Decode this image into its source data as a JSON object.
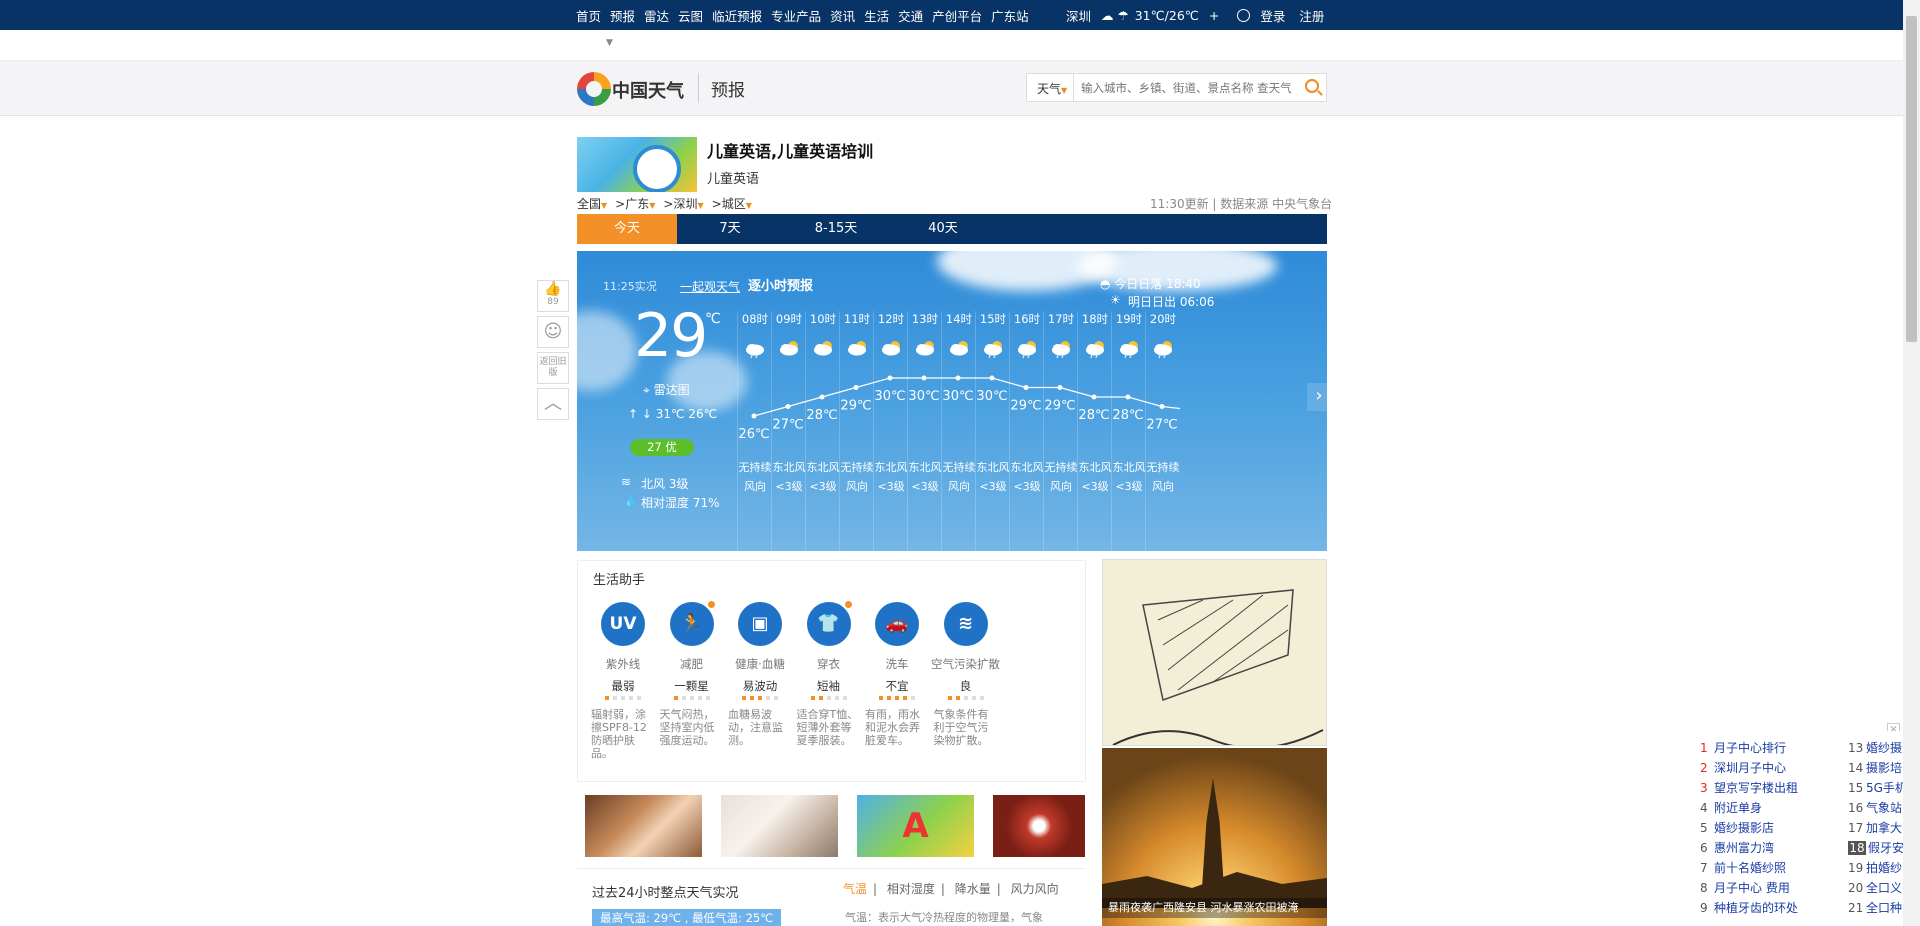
{
  "topnav": {
    "links": [
      "首页",
      "预报",
      "雷达",
      "云图",
      "临近预报",
      "专业产品",
      "资讯",
      "生活",
      "交通",
      "产创平台",
      "广东站"
    ],
    "city": "深圳",
    "temps": "31℃/26℃",
    "plus": "+",
    "login": "登录",
    "register": "注册"
  },
  "header": {
    "logo_text": "中国天气",
    "section": "预报",
    "search_type": "天气",
    "search_placeholder": "输入城市、乡镇、街道、景点名称 查天气"
  },
  "ad": {
    "title": "儿童英语,儿童英语培训",
    "subtitle": "儿童英语"
  },
  "breadcrumb": [
    "全国",
    "广东",
    "深圳",
    "城区"
  ],
  "breadcrumb_sep": ">",
  "update": "11:30更新 | 数据来源 中央气象台",
  "tabs": [
    "今天",
    "7天",
    "8-15天",
    "40天"
  ],
  "current": {
    "time": "11:25实况",
    "together": "一起观天气",
    "temp": "29",
    "unit": "℃",
    "radar": "雷达图",
    "hilo": "31℃   26℃",
    "aqi": "27 优",
    "wind": "北风 3级",
    "humidity": "相对湿度 71%"
  },
  "hourly_title": "逐小时预报",
  "sunset": "今日日落 18:40",
  "sunrise": "明日日出 06:06",
  "hours": [
    {
      "h": "08时",
      "t": 26,
      "icon": "cloud-rain",
      "wd": "无持续",
      "wl": "风向"
    },
    {
      "h": "09时",
      "t": 27,
      "icon": "partly-cloudy",
      "wd": "东北风",
      "wl": "<3级"
    },
    {
      "h": "10时",
      "t": 28,
      "icon": "partly-cloudy",
      "wd": "东北风",
      "wl": "<3级"
    },
    {
      "h": "11时",
      "t": 29,
      "icon": "partly-cloudy",
      "wd": "无持续",
      "wl": "风向"
    },
    {
      "h": "12时",
      "t": 30,
      "icon": "partly-cloudy",
      "wd": "东北风",
      "wl": "<3级"
    },
    {
      "h": "13时",
      "t": 30,
      "icon": "partly-cloudy",
      "wd": "东北风",
      "wl": "<3级"
    },
    {
      "h": "14时",
      "t": 30,
      "icon": "partly-cloudy",
      "wd": "无持续",
      "wl": "风向"
    },
    {
      "h": "15时",
      "t": 30,
      "icon": "partly-rain",
      "wd": "东北风",
      "wl": "<3级"
    },
    {
      "h": "16时",
      "t": 29,
      "icon": "partly-rain",
      "wd": "东北风",
      "wl": "<3级"
    },
    {
      "h": "17时",
      "t": 29,
      "icon": "partly-rain",
      "wd": "无持续",
      "wl": "风向"
    },
    {
      "h": "18时",
      "t": 28,
      "icon": "partly-rain",
      "wd": "东北风",
      "wl": "<3级"
    },
    {
      "h": "19时",
      "t": 28,
      "icon": "partly-rain",
      "wd": "东北风",
      "wl": "<3级"
    },
    {
      "h": "20时",
      "t": 27,
      "icon": "partly-rain",
      "wd": "无持续",
      "wl": "风向"
    }
  ],
  "side": {
    "like_count": "89",
    "old_version": "返回旧版"
  },
  "life": {
    "title": "生活助手",
    "items": [
      {
        "icon": "UV",
        "name": "紫外线",
        "value": "最弱",
        "level": 1,
        "desc": "辐射弱，涂擦SPF8-12防晒护肤品。",
        "dot": false
      },
      {
        "icon": "run",
        "name": "减肥",
        "value": "一颗星",
        "level": 1,
        "desc": "天气闷热，坚持室内低强度运动。",
        "dot": true
      },
      {
        "icon": "glucose",
        "name": "健康·血糖",
        "value": "易波动",
        "level": 3,
        "desc": "血糖易波动，注意监测。",
        "dot": false
      },
      {
        "icon": "shirt",
        "name": "穿衣",
        "value": "短袖",
        "level": 2,
        "desc": "适合穿T恤、短薄外套等夏季服装。",
        "dot": true
      },
      {
        "icon": "car",
        "name": "洗车",
        "value": "不宜",
        "level": 4,
        "desc": "有雨，雨水和泥水会弄脏爱车。",
        "dot": false
      },
      {
        "icon": "wind",
        "name": "空气污染扩散",
        "value": "良",
        "level": 2,
        "desc": "气象条件有利于空气污染物扩散。",
        "dot": false
      }
    ]
  },
  "past24": {
    "title": "过去24小时整点天气实况",
    "tabs": [
      "气温",
      "相对湿度",
      "降水量",
      "风力风向"
    ],
    "badge": "最高气温: 29℃ , 最低气温: 25℃",
    "desc": "气温：表示大气冷热程度的物理量，气象"
  },
  "right_caption": "暴雨夜袭广西隆安县 河水暴涨农田被淹",
  "hotlist": {
    "left": [
      {
        "n": "1",
        "t": "月子中心排行"
      },
      {
        "n": "2",
        "t": "深圳月子中心"
      },
      {
        "n": "3",
        "t": "望京写字楼出租"
      },
      {
        "n": "4",
        "t": "附近单身"
      },
      {
        "n": "5",
        "t": "婚纱摄影店"
      },
      {
        "n": "6",
        "t": "惠州富力湾"
      },
      {
        "n": "7",
        "t": "前十名婚纱照"
      },
      {
        "n": "8",
        "t": "月子中心 费用"
      },
      {
        "n": "9",
        "t": "种植牙齿的环处"
      }
    ],
    "right": [
      {
        "n": "13",
        "t": "婚纱摄"
      },
      {
        "n": "14",
        "t": "摄影培"
      },
      {
        "n": "15",
        "t": "5G手机"
      },
      {
        "n": "16",
        "t": "气象站"
      },
      {
        "n": "17",
        "t": "加拿大"
      },
      {
        "n": "18",
        "t": "假牙安"
      },
      {
        "n": "19",
        "t": "拍婚纱"
      },
      {
        "n": "20",
        "t": "全口义"
      },
      {
        "n": "21",
        "t": "全口种"
      }
    ]
  },
  "colors": {
    "navy": "#073367",
    "orange": "#f39027",
    "sky": "#2f8bd8",
    "aqi_green": "#5cbf2a"
  }
}
